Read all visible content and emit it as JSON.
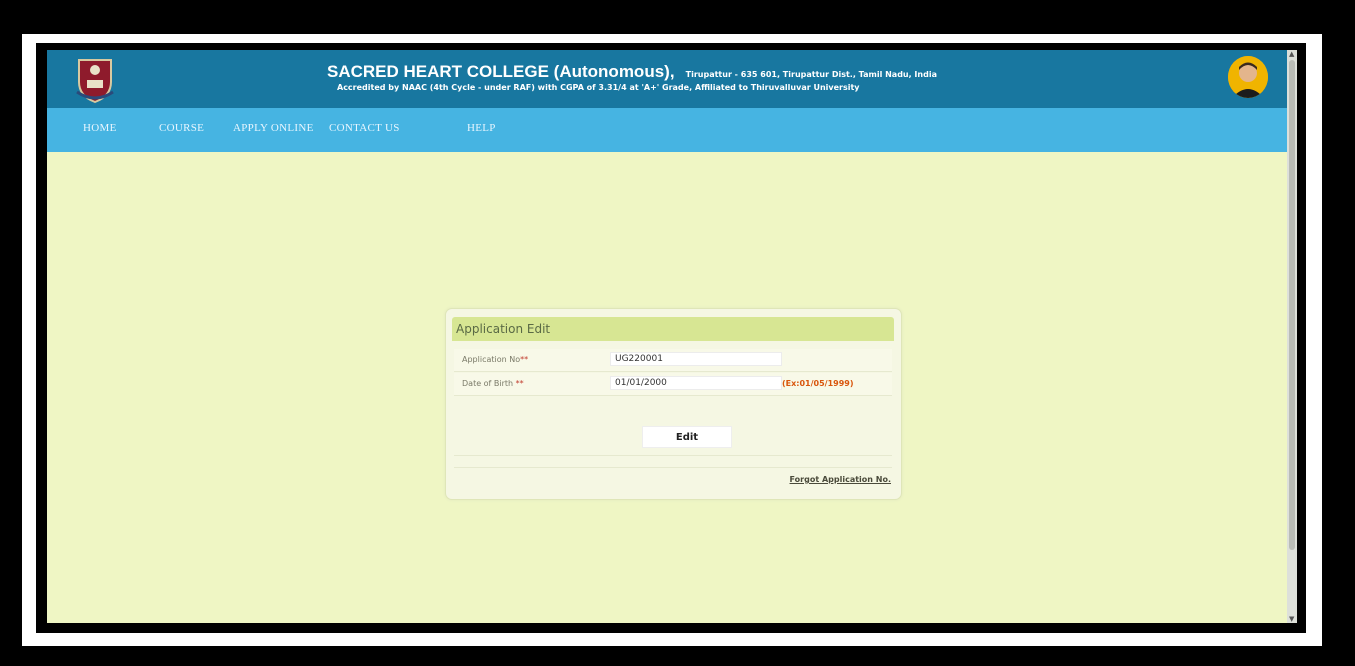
{
  "header": {
    "college_name": "SACRED HEART COLLEGE (Autonomous),",
    "address": "Tirupattur - 635 601, Tirupattur Dist., Tamil Nadu, India",
    "accreditation": "Accredited by NAAC (4th Cycle - under RAF) with CGPA of 3.31/4 at 'A+' Grade, Affiliated to Thiruvalluvar University",
    "logo_icon": "college-crest-icon",
    "avatar_icon": "founder-portrait-icon"
  },
  "nav": {
    "items": [
      "HOME",
      "COURSE",
      "APPLY ONLINE",
      "CONTACT US",
      "HELP"
    ]
  },
  "form": {
    "title": "Application Edit",
    "application_no_label": "Application No",
    "application_no_value": "UG220001",
    "dob_label": "Date of Birth",
    "required_mark": "**",
    "dob_value": "01/01/2000",
    "dob_hint": "(Ex:01/05/1999)",
    "edit_button": "Edit",
    "forgot_link": "Forgot Application No."
  },
  "colors": {
    "header_bg": "#1877a0",
    "nav_bg": "#46b4e2",
    "page_bg": "#eff6c4",
    "panel_head": "#d7e693",
    "hint": "#d9560d"
  }
}
